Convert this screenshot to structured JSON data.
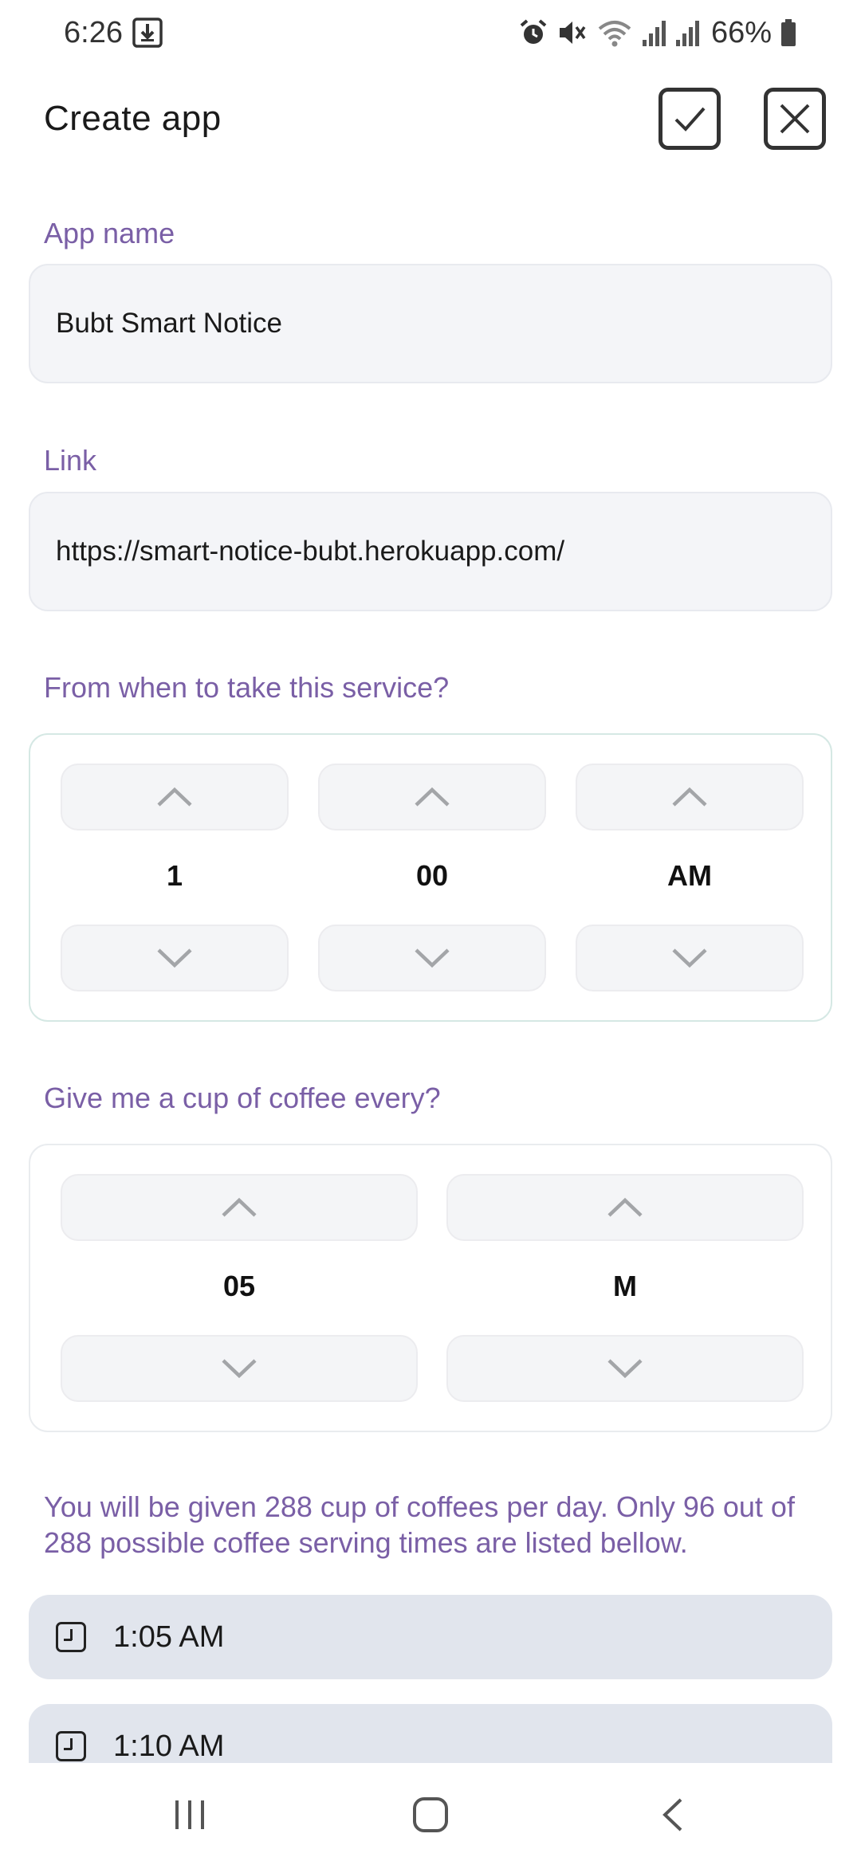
{
  "status_bar": {
    "time": "6:26",
    "battery": "66%"
  },
  "header": {
    "title": "Create app"
  },
  "form": {
    "app_name_label": "App name",
    "app_name_value": "Bubt Smart Notice",
    "link_label": "Link",
    "link_value": "https://smart-notice-bubt.herokuapp.com/",
    "start_label": "From when to take this service?",
    "start_time": {
      "hour": "1",
      "minute": "00",
      "period": "AM"
    },
    "interval_label": "Give me a cup of coffee every?",
    "interval": {
      "value": "05",
      "unit": "M"
    }
  },
  "info_text": "You will be given 288 cup of coffees per day. Only 96 out of 288 possible coffee serving times are listed bellow.",
  "times": [
    "1:05 AM",
    "1:10 AM"
  ],
  "colors": {
    "accent_purple": "#7a5fa6",
    "list_bg": "#e1e5ed",
    "field_bg": "#f4f5f8"
  }
}
